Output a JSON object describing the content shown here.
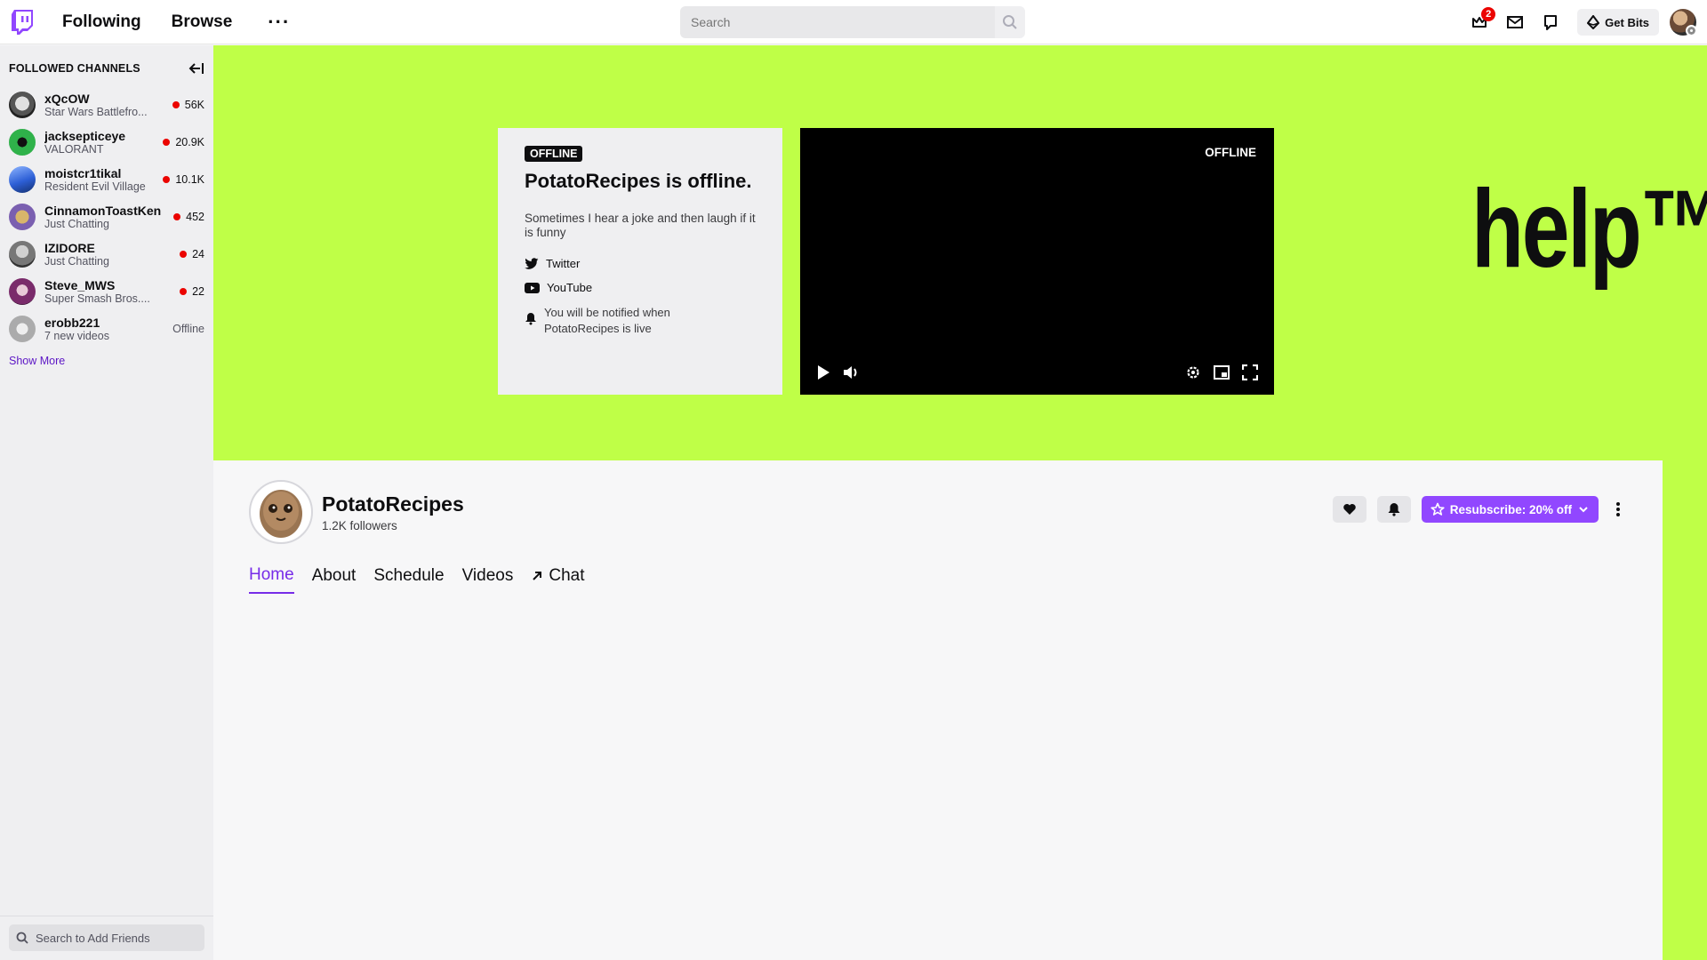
{
  "nav": {
    "following": "Following",
    "browse": "Browse",
    "more": "···",
    "search_placeholder": "Search",
    "inbox_badge": "2",
    "get_bits": "Get Bits"
  },
  "sidebar": {
    "title": "FOLLOWED CHANNELS",
    "channels": [
      {
        "name": "xQcOW",
        "game": "Star Wars Battlefro...",
        "status": "56K",
        "live": true
      },
      {
        "name": "jacksepticeye",
        "game": "VALORANT",
        "status": "20.9K",
        "live": true
      },
      {
        "name": "moistcr1tikal",
        "game": "Resident Evil Village",
        "status": "10.1K",
        "live": true
      },
      {
        "name": "CinnamonToastKen",
        "game": "Just Chatting",
        "status": "452",
        "live": true
      },
      {
        "name": "IZIDORE",
        "game": "Just Chatting",
        "status": "24",
        "live": true
      },
      {
        "name": "Steve_MWS",
        "game": "Super Smash Bros....",
        "status": "22",
        "live": true
      },
      {
        "name": "erobb221",
        "game": "7 new videos",
        "status": "Offline",
        "live": false
      }
    ],
    "show_more": "Show More",
    "friend_search_placeholder": "Search to Add Friends"
  },
  "banner": {
    "offline_badge": "OFFLINE",
    "title": "PotatoRecipes is offline.",
    "description": "Sometimes I hear a joke and then laugh if it is funny",
    "twitter": "Twitter",
    "youtube": "YouTube",
    "notify": "You will be notified when PotatoRecipes is live",
    "player_offline": "OFFLINE",
    "help_text": "help™",
    "bg_color": "#bfff47"
  },
  "channel": {
    "name": "PotatoRecipes",
    "followers": "1.2K followers",
    "resub_label": "Resubscribe: 20% off",
    "accent": "#9147ff",
    "tabs": [
      {
        "label": "Home",
        "active": true
      },
      {
        "label": "About",
        "active": false
      },
      {
        "label": "Schedule",
        "active": false
      },
      {
        "label": "Videos",
        "active": false
      },
      {
        "label": "Chat",
        "active": false
      }
    ]
  }
}
